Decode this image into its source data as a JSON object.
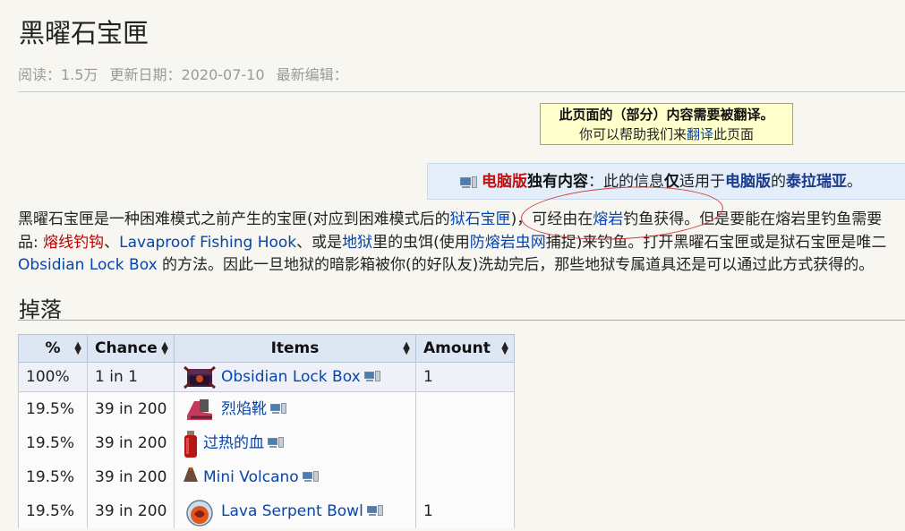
{
  "page": {
    "title": "黑曜石宝匣",
    "meta": {
      "views": "阅读：1.5万",
      "updated": "更新日期：2020-07-10",
      "editors": "最新编辑："
    }
  },
  "translate_notice": {
    "line1": "此页面的（部分）内容需要被翻译。",
    "line2_pre": "你可以帮助我们来",
    "line2_link": "翻译",
    "line2_post": "此页面"
  },
  "pc_notice": {
    "t1": "电脑版",
    "t2": "独有内容",
    "t3": "：此的信息",
    "t4": "仅",
    "t5": "适用于",
    "t6": "电脑版",
    "t7": "的",
    "t8": "泰拉瑞亚",
    "t9": "。"
  },
  "intro": {
    "l1_a": "黑曜石宝匣是一种困难模式之前产生的宝匣(对应到困难模式后的",
    "l1_link1": "狱石宝匣",
    "l1_b": ")，可经由在",
    "l1_link2": "熔岩",
    "l1_c": "钓鱼获得。但是要能在熔岩里钓鱼需要",
    "l2_a": "品: ",
    "l2_link1": "熔线钓钩",
    "l2_b": "、",
    "l2_link2": "Lavaproof Fishing Hook",
    "l2_c": "、或是",
    "l2_link3": "地狱",
    "l2_d": "里的虫饵(使用",
    "l2_link4": "防熔岩虫网",
    "l2_e": "捕捉)来钓鱼。打开黑曜石宝匣或是狱石宝匣是唯二",
    "l3_link1": "Obsidian Lock Box",
    "l3_a": " 的方法。因此一旦地狱的暗影箱被你(的好队友)洗劫完后，那些地狱专属道具还是可以通过此方式获得的。"
  },
  "drops": {
    "heading": "掉落",
    "columns": [
      "%",
      "Chance",
      "Items",
      "Amount"
    ],
    "rows": [
      {
        "pct": "100%",
        "chance": "1 in 1",
        "item": "Obsidian Lock Box",
        "amount": "1"
      },
      {
        "pct": "19.5%",
        "chance": "39 in 200",
        "item": "烈焰靴",
        "amount": ""
      },
      {
        "pct": "19.5%",
        "chance": "39 in 200",
        "item": "过热的血",
        "amount": ""
      },
      {
        "pct": "19.5%",
        "chance": "39 in 200",
        "item": "Mini Volcano",
        "amount": ""
      },
      {
        "pct": "19.5%",
        "chance": "39 in 200",
        "item": "Lava Serpent Bowl",
        "amount": "1"
      }
    ]
  },
  "icons": {
    "pc": "pc-icon",
    "sort": "sort-arrows-icon"
  }
}
